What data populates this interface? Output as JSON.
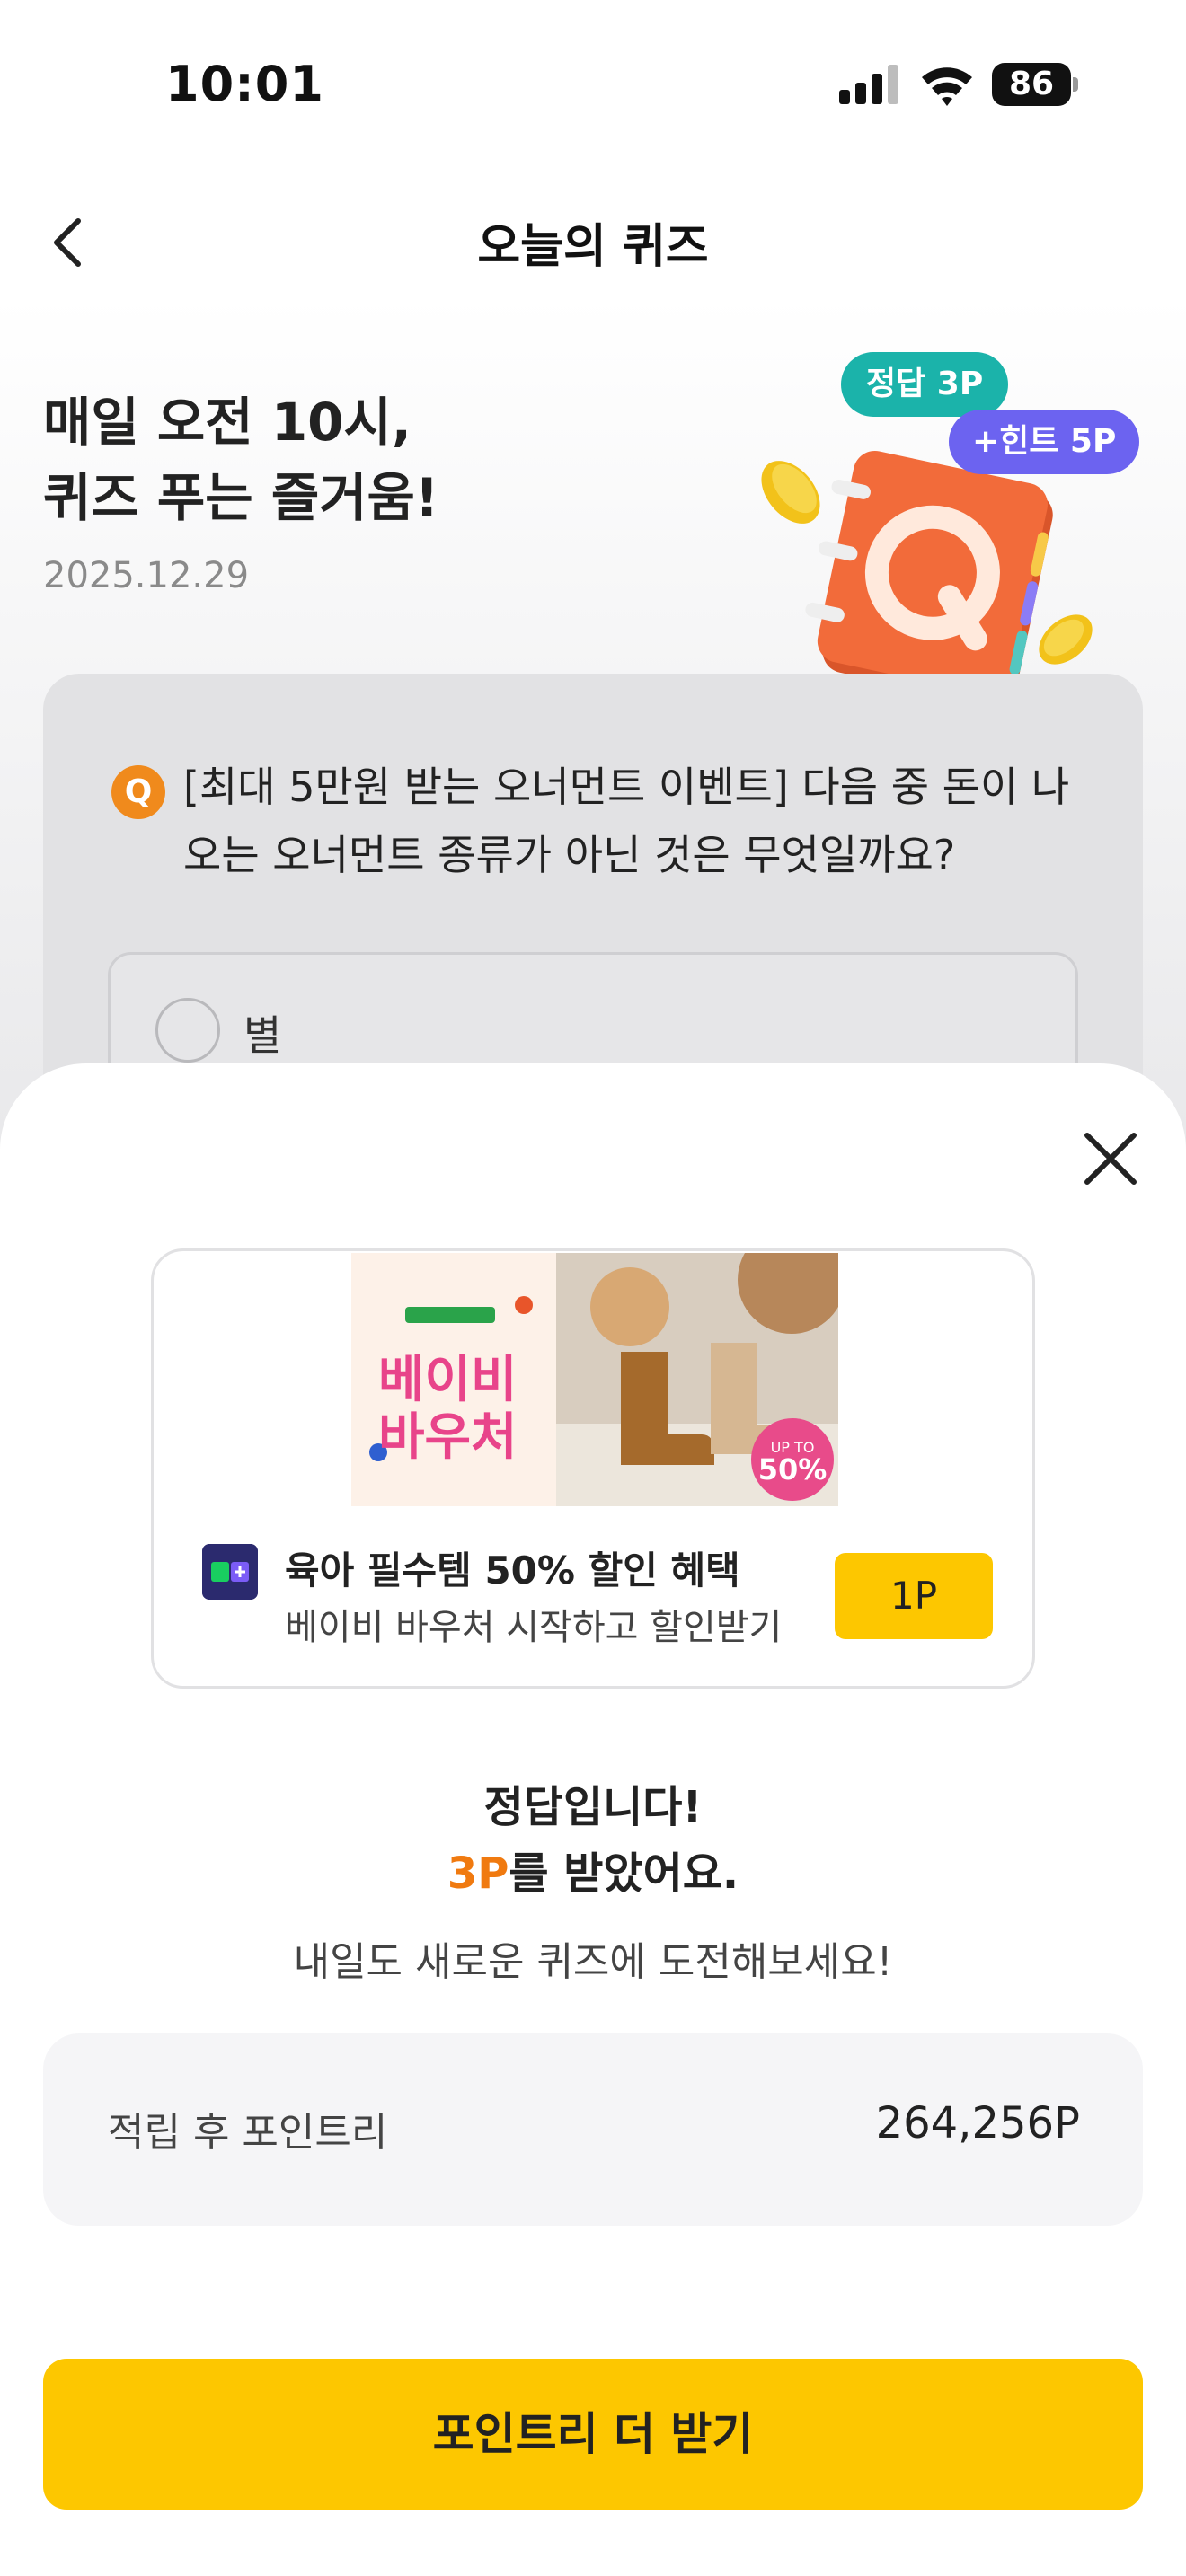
{
  "status_bar": {
    "time": "10:01",
    "battery": "86"
  },
  "header": {
    "title": "오늘의 퀴즈"
  },
  "hero": {
    "title_line1": "매일 오전 10시,",
    "title_line2": "퀴즈 푸는 즐거움!",
    "date": "2025.12.29",
    "tag_correct": "정답 3P",
    "tag_hint": "+힌트 5P",
    "book_letter": "Q"
  },
  "question": {
    "badge": "Q",
    "text": "[최대 5만원 받는 오너먼트 이벤트] 다음 중 돈이 나오는 오너먼트 종류가 아닌 것은 무엇일까요?",
    "options": [
      {
        "label": "별"
      }
    ]
  },
  "ad": {
    "banner_text_line1": "베이비",
    "banner_text_line2": "바우처",
    "banner_badge_top": "UP TO",
    "banner_badge_value": "50%",
    "title": "육아 필수템 50% 할인 혜택",
    "subtitle": "베이비 바우처 시작하고 할인받기",
    "button": "1P"
  },
  "result": {
    "line1": "정답입니다!",
    "points_earned": "3P",
    "line2_suffix": "를 받았어요.",
    "line3": "내일도 새로운 퀴즈에 도전해보세요!"
  },
  "points_box": {
    "label": "적립 후 포인트리",
    "value": "264,256P"
  },
  "cta": {
    "label": "포인트리 더 받기"
  },
  "colors": {
    "primary_yellow": "#fdc700",
    "accent_orange": "#f07a10",
    "tag_teal": "#1bb3aa",
    "tag_purple": "#6c63f0",
    "book_orange": "#f26b3a"
  }
}
